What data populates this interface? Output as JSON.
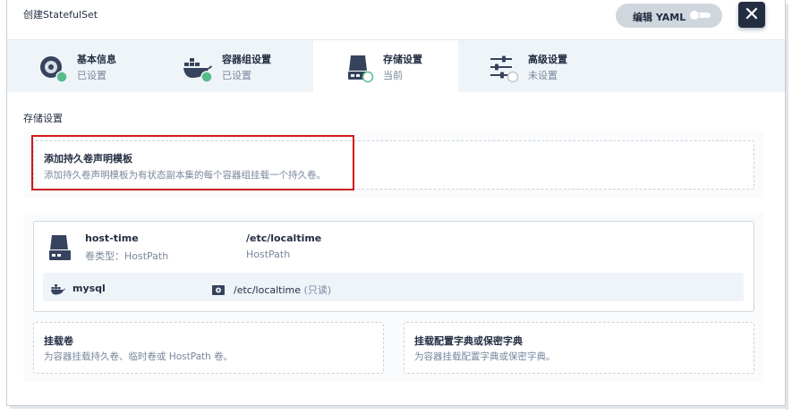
{
  "dialog": {
    "title": "创建StatefulSet"
  },
  "header": {
    "edit_yaml_label": "编辑 YAML",
    "close_symbol": "✕"
  },
  "tabs": [
    {
      "label": "基本信息",
      "status": "已设置",
      "icon": "disk-icon"
    },
    {
      "label": "容器组设置",
      "status": "已设置",
      "icon": "docker-whale-icon"
    },
    {
      "label": "存储设置",
      "status": "当前",
      "icon": "storage-drive-icon"
    },
    {
      "label": "高级设置",
      "status": "未设置",
      "icon": "sliders-icon"
    }
  ],
  "storage": {
    "section_title": "存储设置",
    "pvc_template": {
      "title": "添加持久卷声明模板",
      "description": "添加持久卷声明模板为有状态副本集的每个容器组挂载一个持久卷。"
    },
    "volume": {
      "name": "host-time",
      "type_label": "卷类型：HostPath",
      "path": "/etc/localtime",
      "path_type": "HostPath",
      "mount": {
        "container": "mysql",
        "mount_path": "/etc/localtime",
        "mode": "(只读)"
      }
    },
    "mount_volume": {
      "title": "挂载卷",
      "description": "为容器挂载持久卷、临时卷或 HostPath 卷。"
    },
    "mount_config": {
      "title": "挂载配置字典或保密字典",
      "description": "为容器挂载配置字典或保密字典。"
    }
  },
  "colors": {
    "accent_dark": "#242e42",
    "status_green": "#55bc8a",
    "highlight_red": "#d0191d",
    "muted_text": "#79879c"
  }
}
